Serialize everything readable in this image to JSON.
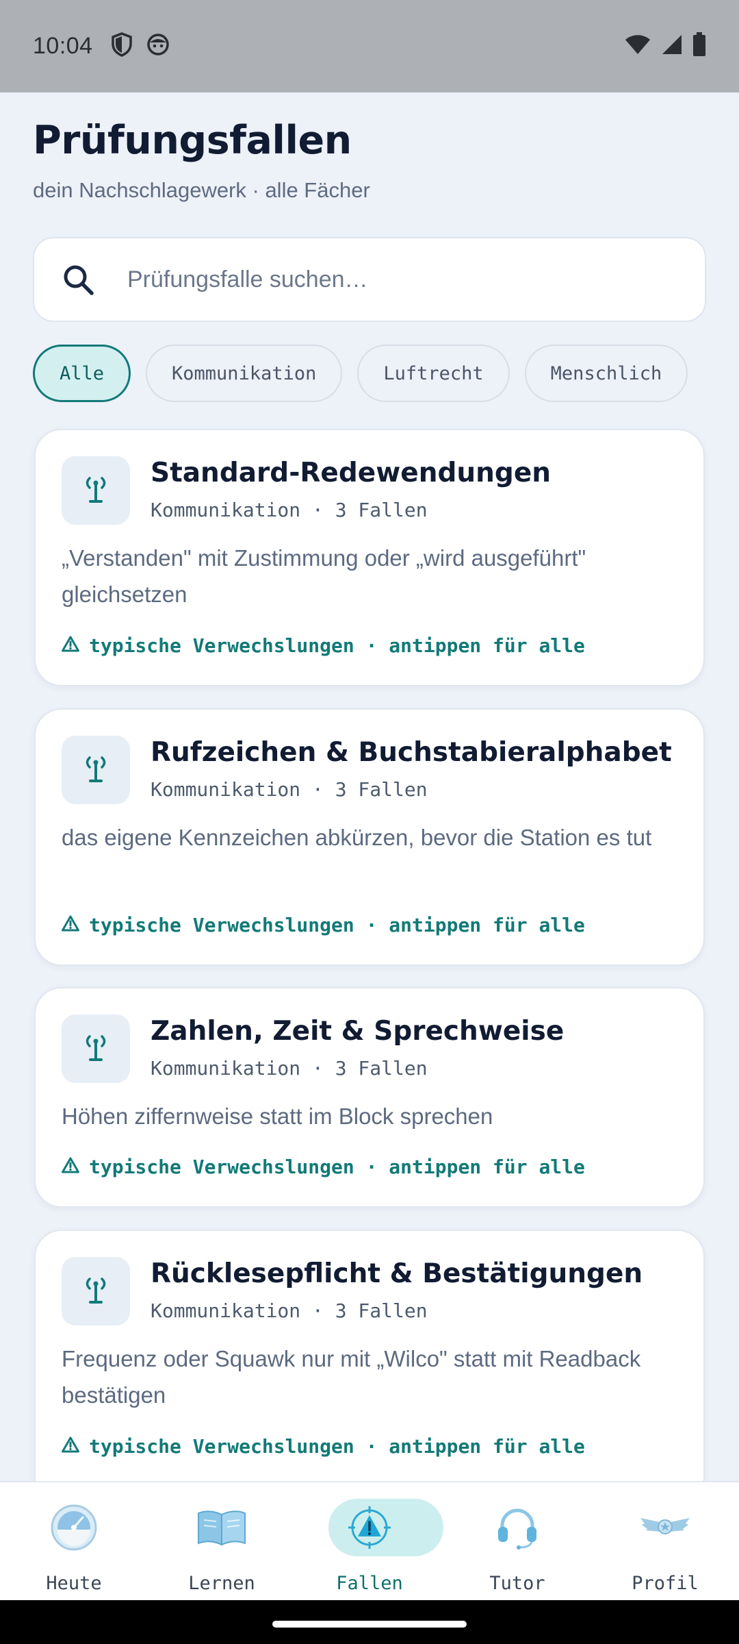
{
  "status_bar": {
    "time": "10:04"
  },
  "header": {
    "title": "Prüfungsfallen",
    "subtitle": "dein Nachschlagewerk · alle Fächer"
  },
  "search": {
    "placeholder": "Prüfungsfalle suchen…",
    "value": ""
  },
  "filters": [
    {
      "label": "Alle",
      "active": true
    },
    {
      "label": "Kommunikation",
      "active": false
    },
    {
      "label": "Luftrecht",
      "active": false
    },
    {
      "label": "Menschlich",
      "active": false
    }
  ],
  "cards": [
    {
      "title": "Standard-Redewendungen",
      "meta": "Kommunikation · 3 Fallen",
      "description": "„Verstanden\" mit Zustimmung oder „wird ausgeführt\" gleichsetzen",
      "hint": "typische Verwechslungen · antippen für alle"
    },
    {
      "title": "Rufzeichen & Buchstabieralphabet",
      "meta": "Kommunikation · 3 Fallen",
      "description": "das eigene Kennzeichen abkürzen, bevor die Station es tut",
      "hint": "typische Verwechslungen · antippen für alle"
    },
    {
      "title": "Zahlen, Zeit & Sprechweise",
      "meta": "Kommunikation · 3 Fallen",
      "description": "Höhen ziffernweise statt im Block sprechen",
      "hint": "typische Verwechslungen · antippen für alle"
    },
    {
      "title": "Rücklesepflicht & Bestätigungen",
      "meta": "Kommunikation · 3 Fallen",
      "description": "Frequenz oder Squawk nur mit „Wilco\" statt mit Readback bestätigen",
      "hint": "typische Verwechslungen · antippen für alle"
    }
  ],
  "nav": [
    {
      "label": "Heute",
      "icon": "gauge-icon",
      "active": false
    },
    {
      "label": "Lernen",
      "icon": "open-book-icon",
      "active": false
    },
    {
      "label": "Fallen",
      "icon": "warning-target-icon",
      "active": true
    },
    {
      "label": "Tutor",
      "icon": "headset-icon",
      "active": false
    },
    {
      "label": "Profil",
      "icon": "pilot-wings-icon",
      "active": false
    }
  ],
  "colors": {
    "accent": "#127a78",
    "background": "#edf1f8",
    "active_pill": "#cdeeee"
  }
}
